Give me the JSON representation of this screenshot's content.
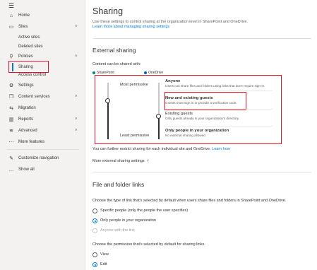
{
  "sidebar": {
    "items": [
      {
        "label": "Home",
        "icon": "home-icon",
        "glyph": "⌂"
      },
      {
        "label": "Sites",
        "icon": "sites-icon",
        "glyph": "▭",
        "chev": "˄"
      },
      {
        "label": "Active sites"
      },
      {
        "label": "Deleted sites"
      },
      {
        "label": "Policies",
        "icon": "policies-icon",
        "glyph": "⚲",
        "chev": "˄"
      },
      {
        "label": "Sharing"
      },
      {
        "label": "Access control"
      },
      {
        "label": "Settings",
        "icon": "settings-icon",
        "glyph": "⚙"
      },
      {
        "label": "Content services",
        "icon": "content-services-icon",
        "glyph": "❐",
        "chev": "˅"
      },
      {
        "label": "Migration",
        "icon": "migration-icon",
        "glyph": "⇆"
      },
      {
        "label": "Reports",
        "icon": "reports-icon",
        "glyph": "▥",
        "chev": "˅"
      },
      {
        "label": "Advanced",
        "icon": "advanced-icon",
        "glyph": "≋",
        "chev": "˅"
      },
      {
        "label": "More features",
        "icon": "more-features-icon",
        "glyph": "⋯"
      },
      {
        "label": "Customize navigation",
        "icon": "pencil-icon",
        "glyph": "✎"
      },
      {
        "label": "Show all",
        "icon": "ellipsis-icon",
        "glyph": "…"
      }
    ]
  },
  "main": {
    "title": "Sharing",
    "description": "Use these settings to control sharing at the organization level in SharePoint and OneDrive.",
    "learn_more": "Learn more about managing sharing settings",
    "external": {
      "title": "External sharing",
      "content_label": "Content can be shared with:",
      "sharepoint": "SharePoint",
      "onedrive": "OneDrive",
      "most_permissive": "Most permissive",
      "least_permissive": "Least permissive",
      "levels": [
        {
          "title": "Anyone",
          "desc": "Users can share files and folders using links that don't require sign-in."
        },
        {
          "title": "New and existing guests",
          "desc": "Guests must sign in or provide a verification code."
        },
        {
          "title": "Existing guests",
          "desc": "Only guests already in your organization's directory."
        },
        {
          "title": "Only people in your organization",
          "desc": "No external sharing allowed."
        }
      ],
      "restrict_note": "You can further restrict sharing for each individual site and OneDrive.",
      "learn_how": "Learn how",
      "more_settings": "More external sharing settings"
    },
    "file_links": {
      "title": "File and folder links",
      "type_prompt": "Choose the type of link that's selected by default when users share files and folders in SharePoint and OneDrive.",
      "type_options": [
        "Specific people (only the people the user specifies)",
        "Only people in your organization",
        "Anyone with the link"
      ],
      "perm_prompt": "Choose the permission that's selected by default for sharing links.",
      "perm_options": [
        "View",
        "Edit"
      ]
    }
  },
  "colors": {
    "accent": "#0078d4",
    "highlight": "#e81123",
    "sharepoint": "#038387",
    "onedrive": "#0364b8"
  }
}
